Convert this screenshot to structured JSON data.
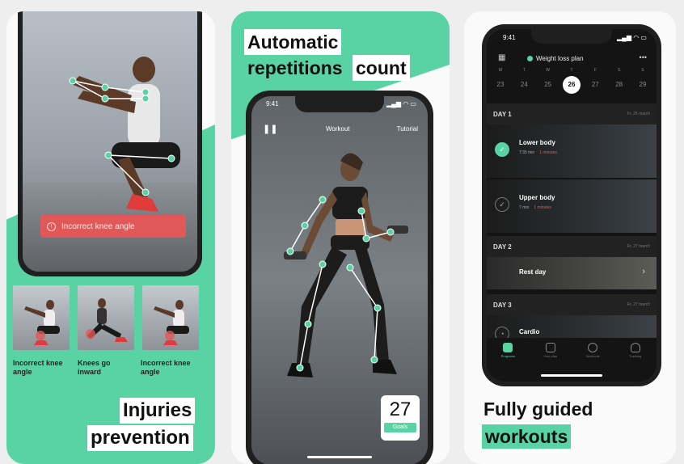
{
  "panel1": {
    "alert": {
      "text": "Incorrect knee angle",
      "icon": "warning-circle-icon"
    },
    "thumbs": [
      {
        "label": "Incorrect knee angle"
      },
      {
        "label": "Knees go inward"
      },
      {
        "label": "Incorrect knee angle"
      }
    ],
    "headline": {
      "line1": "Injuries",
      "line2": "prevention"
    }
  },
  "panel2": {
    "headline": {
      "line1": "Automatic",
      "line2a": "repetitions",
      "line2b": "count"
    },
    "status_time": "9:41",
    "tabs": {
      "left": "Workout",
      "right": "Tutorial"
    },
    "counter": {
      "value": "27",
      "label": "Goals"
    }
  },
  "panel3": {
    "status_time": "9:41",
    "plan_title": "Weight loss plan",
    "more_label": "•••",
    "weekdays": [
      "M",
      "T",
      "W",
      "T",
      "F",
      "S",
      "S"
    ],
    "dates": [
      "23",
      "24",
      "25",
      "26",
      "27",
      "28",
      "29"
    ],
    "active_date_index": 3,
    "days": [
      {
        "label": "DAY 1",
        "date": "Fr, 25 march"
      },
      {
        "label": "DAY 2",
        "date": "Fr, 27 march"
      },
      {
        "label": "DAY 3",
        "date": "Fr, 27 march"
      }
    ],
    "workouts": [
      {
        "title": "Lower body",
        "duration": "7:35 min",
        "extra": "1 minutes",
        "done": true
      },
      {
        "title": "Upper body",
        "duration": "7 min",
        "extra": "1 minutes",
        "done": false
      },
      {
        "title": "Rest day"
      },
      {
        "title": "Cardio"
      }
    ],
    "tabbar": [
      "Programs",
      "Your plan",
      "Workouts",
      "Tracking"
    ],
    "headline": {
      "line1": "Fully guided",
      "line2": "workouts"
    }
  },
  "colors": {
    "accent": "#59d3a4",
    "alert": "#e25858",
    "dark": "#1f1f1f"
  }
}
